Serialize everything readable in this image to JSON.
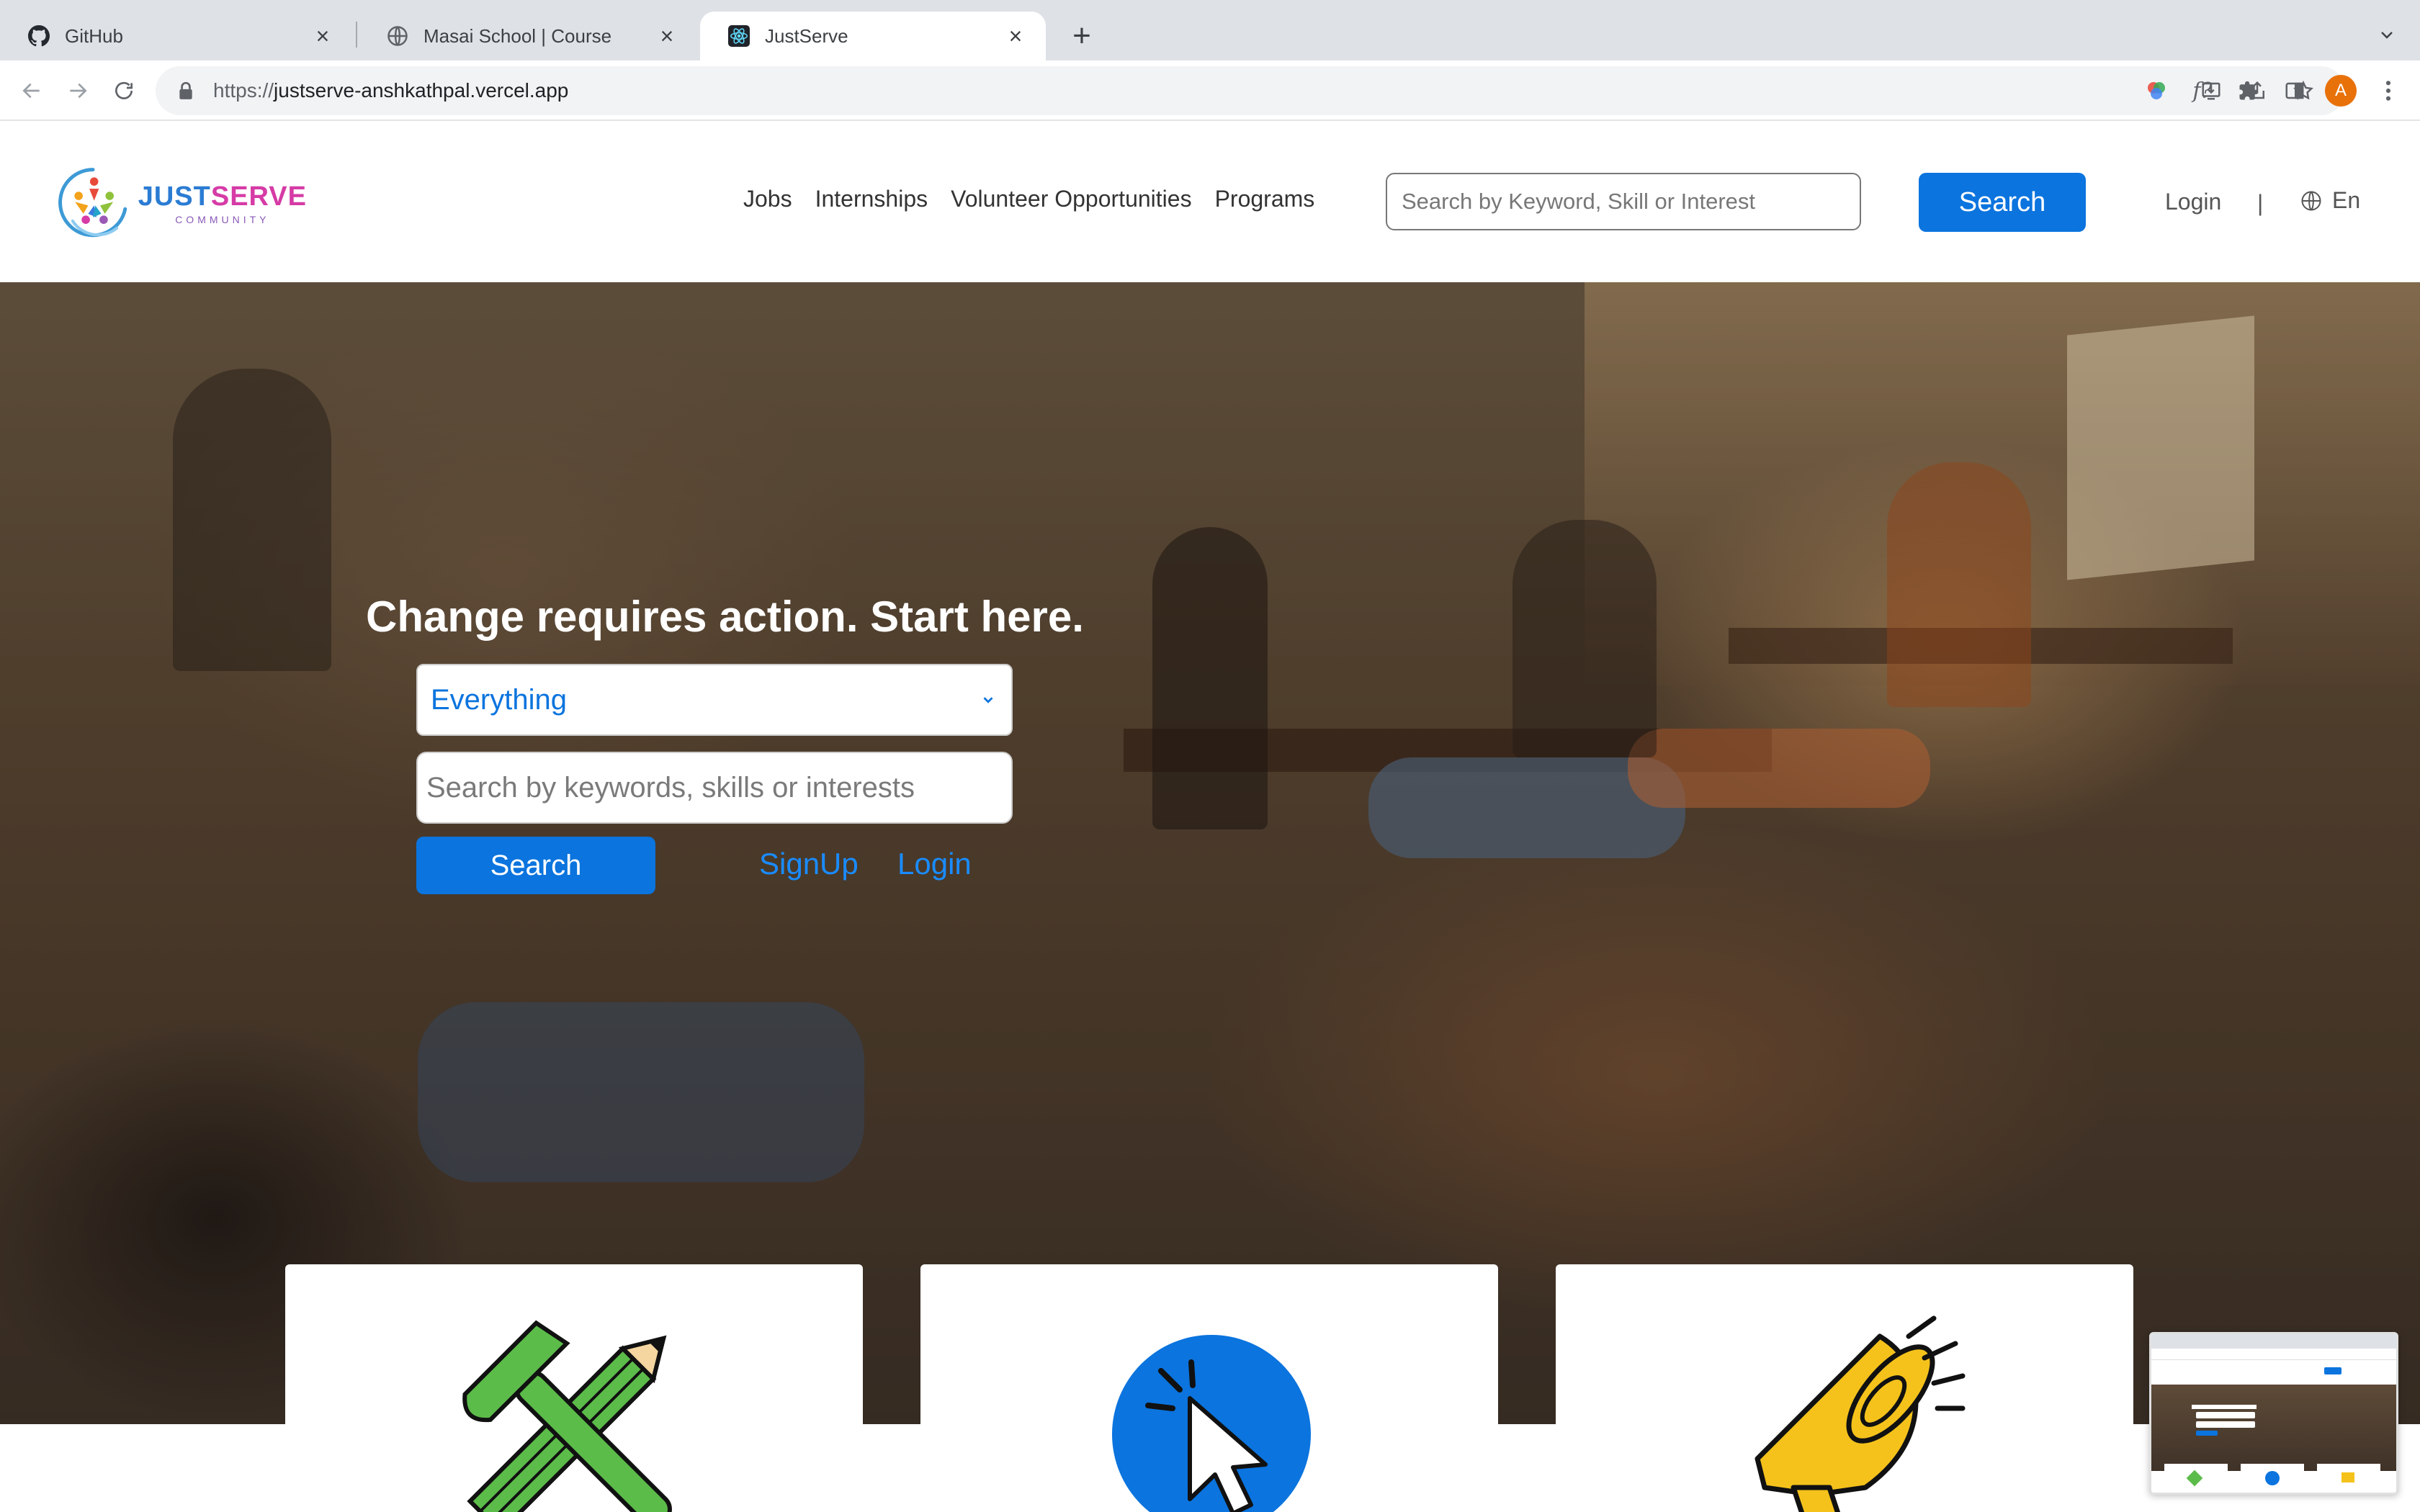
{
  "browser": {
    "tabs": [
      {
        "label": "GitHub",
        "icon": "github-icon"
      },
      {
        "label": "Masai School | Course",
        "icon": "globe-icon"
      },
      {
        "label": "JustServe",
        "icon": "react-icon"
      }
    ],
    "url_prefix": "https://",
    "url_host": "justserve-anshkathpal.vercel.app",
    "profile_initial": "A",
    "profile_color": "#e8710a"
  },
  "header": {
    "logo": {
      "brand_part1": "JUST",
      "brand_part2": "SERVE",
      "subtitle": "COMMUNITY"
    },
    "nav": [
      "Jobs",
      "Internships",
      "Volunteer Opportunities",
      "Programs"
    ],
    "search_placeholder": "Search by Keyword, Skill or Interest",
    "search_label": "Search",
    "login_label": "Login",
    "divider": "|",
    "language": "En"
  },
  "hero": {
    "title": "Change requires action. Start here.",
    "category_selected": "Everything",
    "keyword_placeholder": "Search by keywords, skills or interests",
    "search_label": "Search",
    "signup_label": "SignUp",
    "login_label": "Login"
  },
  "cards": [
    {
      "icon": "hammer-pencil-icon"
    },
    {
      "icon": "cursor-click-icon"
    },
    {
      "icon": "megaphone-icon"
    }
  ],
  "colors": {
    "primary": "#0b74de",
    "link": "#1a8cff",
    "brand_blue": "#2b7cd3",
    "brand_pink": "#d63ba6"
  }
}
